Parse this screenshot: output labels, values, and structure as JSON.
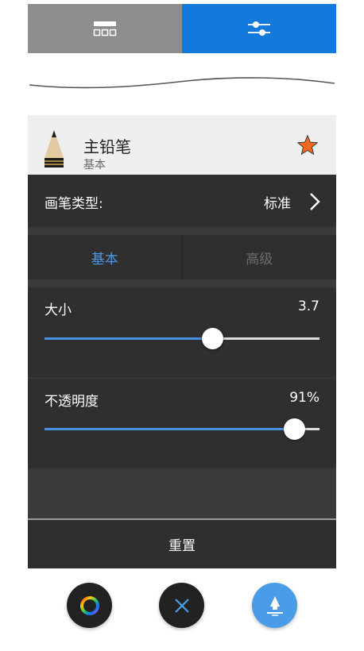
{
  "brush": {
    "title": "主铅笔",
    "subtitle": "基本"
  },
  "brush_type": {
    "label": "画笔类型:",
    "value": "标准"
  },
  "tabs": {
    "basic": "基本",
    "advanced": "高级"
  },
  "sliders": {
    "size": {
      "label": "大小",
      "value": "3.7",
      "fraction": 0.61
    },
    "opacity": {
      "label": "不透明度",
      "value": "91%",
      "fraction": 0.91
    }
  },
  "reset_label": "重置",
  "icons": {
    "top_left": "brush-grid-icon",
    "top_right": "sliders-icon",
    "favorite": "star-icon",
    "type_next": "chevron-right-icon",
    "color": "color-wheel-icon",
    "close": "close-icon",
    "brush": "brush-tool-icon"
  },
  "colors": {
    "accent": "#1479dc",
    "star": "#f06a22",
    "slider_fill": "#4a90e2",
    "panel_dark": "#2f2f2f"
  }
}
